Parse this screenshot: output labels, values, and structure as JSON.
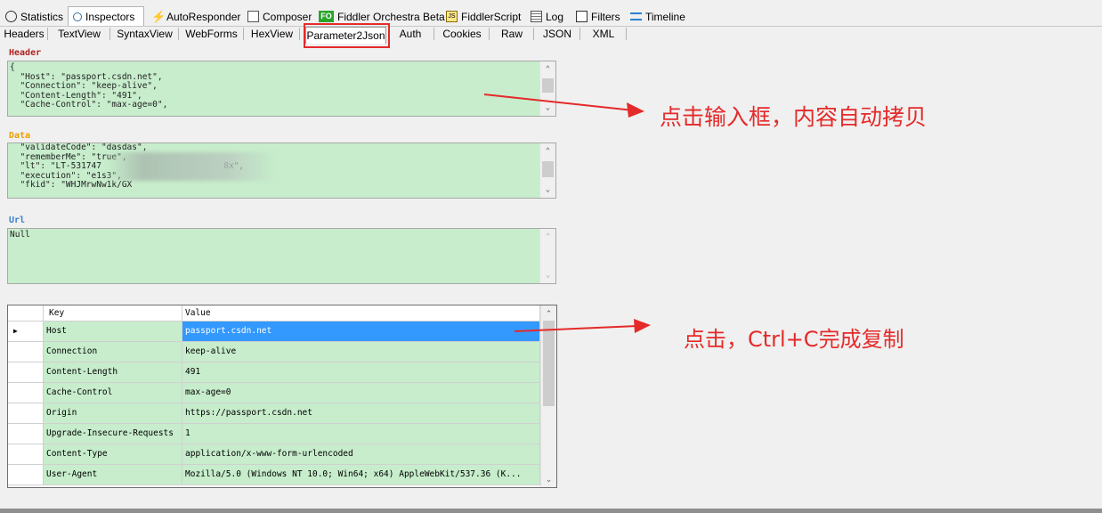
{
  "top_tabs": [
    {
      "label": "Statistics",
      "icon": "stopwatch-icon"
    },
    {
      "label": "Inspectors",
      "icon": "magnifier-icon",
      "active": true
    },
    {
      "label": "AutoResponder",
      "icon": "lightning-icon"
    },
    {
      "label": "Composer",
      "icon": "composer-icon"
    },
    {
      "label": "Fiddler Orchestra Beta",
      "icon": "fo-icon",
      "badge": "FO"
    },
    {
      "label": "FiddlerScript",
      "icon": "js-script-icon",
      "badge": "JS"
    },
    {
      "label": "Log",
      "icon": "log-icon"
    },
    {
      "label": "Filters",
      "icon": "checkbox-icon"
    },
    {
      "label": "Timeline",
      "icon": "timeline-icon"
    }
  ],
  "sub_tabs": [
    "Headers",
    "TextView",
    "SyntaxView",
    "WebForms",
    "HexView",
    "Parameter2Json",
    "Auth",
    "Cookies",
    "Raw",
    "JSON",
    "XML"
  ],
  "active_sub_tab": "Parameter2Json",
  "sections": {
    "header_label": "Header",
    "header_text": "{\n  \"Host\": \"passport.csdn.net\",\n  \"Connection\": \"keep-alive\",\n  \"Content-Length\": \"491\",\n  \"Cache-Control\": \"max-age=0\",",
    "data_label": "Data",
    "data_text": "  \"validateCode\": \"dasdas\",\n  \"rememberMe\": \"true\",\n  \"lt\": \"LT-531747                        8x\",\n  \"execution\": \"e1s3\",\n  \"fkid\": \"WHJMrwNw1k/GX",
    "url_label": "Url",
    "url_text": "Null"
  },
  "grid": {
    "columns": [
      "Key",
      "Value"
    ],
    "rows": [
      {
        "key": "Host",
        "value": "passport.csdn.net",
        "selected": true
      },
      {
        "key": "Connection",
        "value": "keep-alive"
      },
      {
        "key": "Content-Length",
        "value": "491"
      },
      {
        "key": "Cache-Control",
        "value": "max-age=0"
      },
      {
        "key": "Origin",
        "value": "https://passport.csdn.net"
      },
      {
        "key": "Upgrade-Insecure-Requests",
        "value": "1"
      },
      {
        "key": "Content-Type",
        "value": "application/x-www-form-urlencoded"
      },
      {
        "key": "User-Agent",
        "value": "Mozilla/5.0 (Windows NT 10.0; Win64; x64) AppleWebKit/537.36 (K..."
      }
    ]
  },
  "annotations": {
    "note1": "点击输入框，内容自动拷贝",
    "note2": "点击，Ctrl+C完成复制"
  },
  "colors": {
    "text_bg": "#c7edcc",
    "selected_row": "#3399ff",
    "annotation_red": "#e52a2a",
    "header_label": "#b22222",
    "data_label": "#e8a000",
    "url_label": "#3a7fd0"
  }
}
